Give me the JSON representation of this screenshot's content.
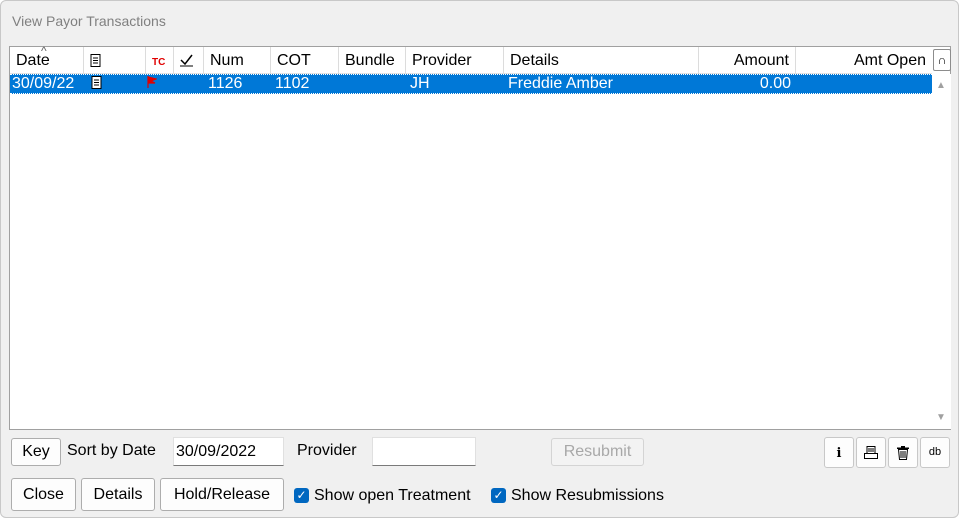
{
  "window": {
    "title": "View Payor Transactions"
  },
  "grid": {
    "sort_indicator": "^",
    "columns": [
      {
        "label": "Date"
      },
      {
        "label": "",
        "icon": "document-icon"
      },
      {
        "label": "TC"
      },
      {
        "label": "",
        "icon": "checkmark-icon"
      },
      {
        "label": "Num"
      },
      {
        "label": "COT"
      },
      {
        "label": "Bundle"
      },
      {
        "label": "Provider"
      },
      {
        "label": "Details"
      },
      {
        "label": "Amount"
      },
      {
        "label": "Amt Open"
      }
    ],
    "rows": [
      {
        "date": "30/09/22",
        "doc_icon": "document-icon",
        "tc_icon": "red-flag-icon",
        "num": "1126",
        "cot": "1102",
        "bundle": "",
        "provider": "JH",
        "details": "Freddie Amber",
        "amount": "0.00",
        "amt_open": ""
      }
    ],
    "selected_row": 0
  },
  "controls": {
    "key_label": "Key",
    "sort_label": "Sort by Date",
    "date_value": "30/09/2022",
    "provider_label": "Provider",
    "provider_value": "",
    "resubmit_label": "Resubmit",
    "close_label": "Close",
    "details_label": "Details",
    "hold_release_label": "Hold/Release",
    "show_open_treatment_label": "Show open Treatment",
    "show_open_treatment_checked": true,
    "show_resubmissions_label": "Show Resubmissions",
    "show_resubmissions_checked": true,
    "db_label": "db"
  },
  "colors": {
    "selection": "#0078d7",
    "checkbox": "#0067c0",
    "tc_red": "#e00000"
  }
}
